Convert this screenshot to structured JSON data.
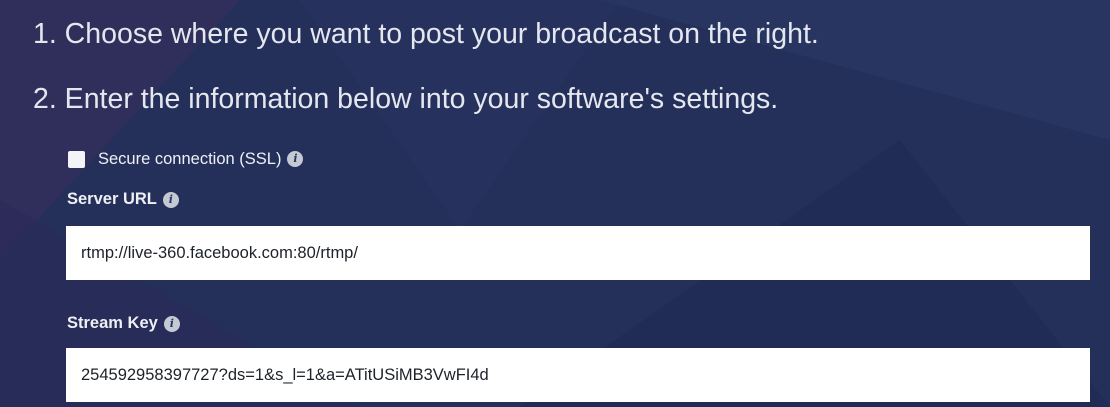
{
  "instructions": {
    "step1": "1. Choose where you want to post your broadcast on the right.",
    "step2": "2. Enter the information below into your software's settings."
  },
  "ssl": {
    "label": "Secure connection (SSL)",
    "checked": false,
    "info_icon": "info-icon"
  },
  "server_url": {
    "label": "Server URL",
    "value": "rtmp://live-360.facebook.com:80/rtmp/",
    "info_icon": "info-icon"
  },
  "stream_key": {
    "label": "Stream Key",
    "value": "254592958397727?ds=1&s_l=1&a=ATitUSiMB3VwFI4d",
    "info_icon": "info-icon"
  },
  "colors": {
    "background": "#24305a",
    "text": "#e4e7ee",
    "field_background": "#ffffff"
  }
}
